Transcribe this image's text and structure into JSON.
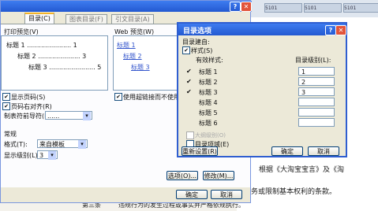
{
  "document": {
    "ruler_tabs": [
      "5101",
      "5101",
      "5101"
    ],
    "lines": [
      {
        "text": "根据《大淘宝宝言》及《淘"
      },
      {
        "text": "务或限制基本权利的条款。"
      },
      {
        "text": "违规行为的发生过程或事实并严格依规执行。"
      }
    ],
    "footer_fragment": "第三条"
  },
  "dialog": {
    "title_help": "?",
    "title_close": "✕",
    "tabs": [
      "目录(C)",
      "图表目录(F)",
      "引文目录(A)"
    ],
    "print_preview_label": "打印预览(V)",
    "web_preview_label": "Web 预览(W)",
    "print_preview": [
      {
        "text": "标题 1 ...................... 1"
      },
      {
        "text": "标题 2 ..................... 3"
      },
      {
        "text": "标题 3 ....................... 5"
      }
    ],
    "web_preview": [
      "标题 1",
      "标题 2",
      "标题 3"
    ],
    "show_page_numbers": "显示页码(S)",
    "right_align": "页码右对齐(R)",
    "tab_leader_label": "制表符前导符(B):",
    "tab_leader_value": "......",
    "use_hyperlinks": "使用超链接而不使用页码",
    "general_label": "常规",
    "format_label": "格式(T):",
    "format_value": "来自模板",
    "levels_label": "显示级别(L):",
    "levels_value": "3",
    "options_button": "选项(O)...",
    "modify_button": "修改(M)...",
    "ok_button": "确定",
    "cancel_button": "取消"
  },
  "toc_options": {
    "title": "目录选项",
    "title_help": "?",
    "title_close": "✕",
    "build_from": "目录建自:",
    "styles_label": "样式(S)",
    "available_styles": "有效样式:",
    "toc_level": "目录级别(L):",
    "styles": [
      {
        "checked": "✔",
        "name": "标题 1",
        "level": "1"
      },
      {
        "checked": "✔",
        "name": "标题 2",
        "level": "2"
      },
      {
        "checked": "✔",
        "name": "标题 3",
        "level": "3"
      },
      {
        "checked": "",
        "name": "标题 4",
        "level": ""
      },
      {
        "checked": "",
        "name": "标题 5",
        "level": ""
      },
      {
        "checked": "",
        "name": "标题 6",
        "level": ""
      }
    ],
    "outline_level": "大纲级别(O)",
    "toc_entry_fields": "目录项域(E)",
    "reset_button": "重新设置(R)",
    "ok_button": "确定",
    "cancel_button": "取消"
  },
  "colors": {
    "title_bar": "#2359d1",
    "dialog_bg": "#ece9d8",
    "link": "#3355cc"
  }
}
